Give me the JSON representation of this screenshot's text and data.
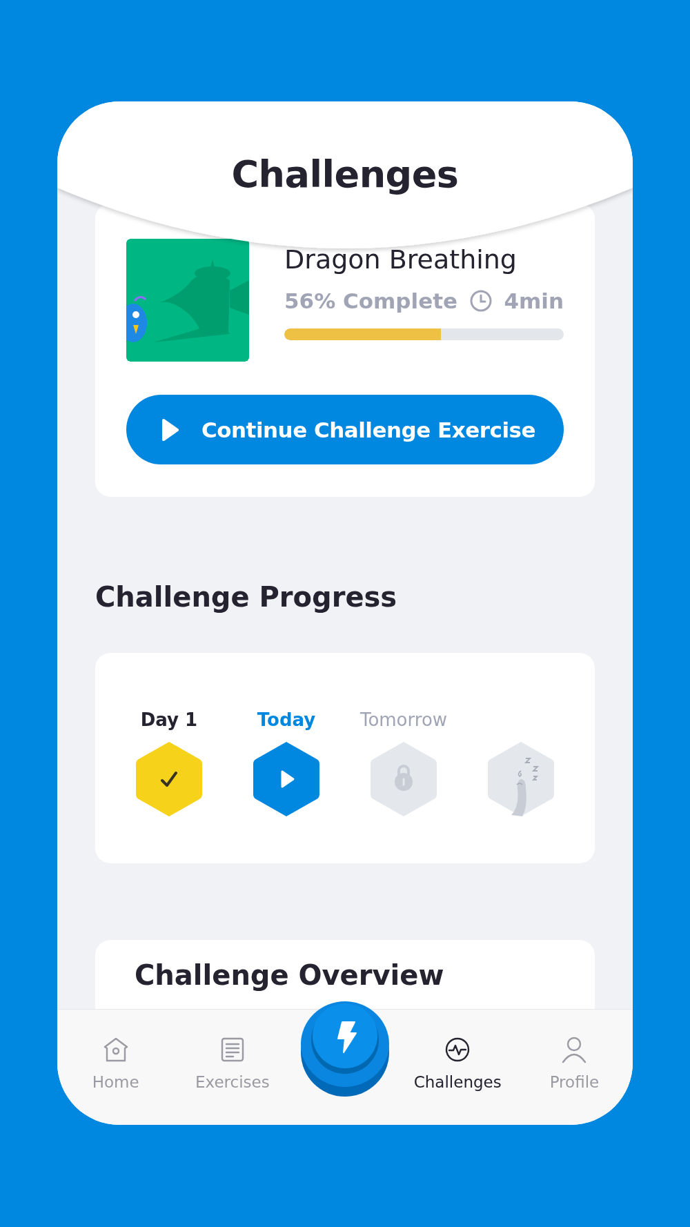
{
  "header": {
    "title": "Challenges"
  },
  "current_exercise": {
    "kind": "picture",
    "title": "Dragon Breathing",
    "progress_text": "56% Complete",
    "duration": "4min",
    "level": 0.56,
    "button": "Continue Challenge Exercise"
  },
  "progress_section": {
    "heading": "Challenge Progress",
    "days": [
      {
        "label": "Day 1",
        "kind": "done"
      },
      {
        "label": "Today",
        "kind": "current"
      },
      {
        "label": "Tomorrow",
        "kind": "locked"
      },
      {
        "kind": "resting"
      }
    ]
  },
  "overview_section": {
    "heading": "Challenge Overview"
  },
  "bottom_nav": [
    {
      "kind": "home",
      "label": "Home",
      "selected": false
    },
    {
      "kind": "exercises",
      "label": "Exercises",
      "selected": false
    },
    {
      "kind": "action",
      "selected": false
    },
    {
      "kind": "challenges",
      "label": "Challenges",
      "selected": true
    },
    {
      "kind": "profile",
      "label": "Profile",
      "selected": false
    }
  ]
}
